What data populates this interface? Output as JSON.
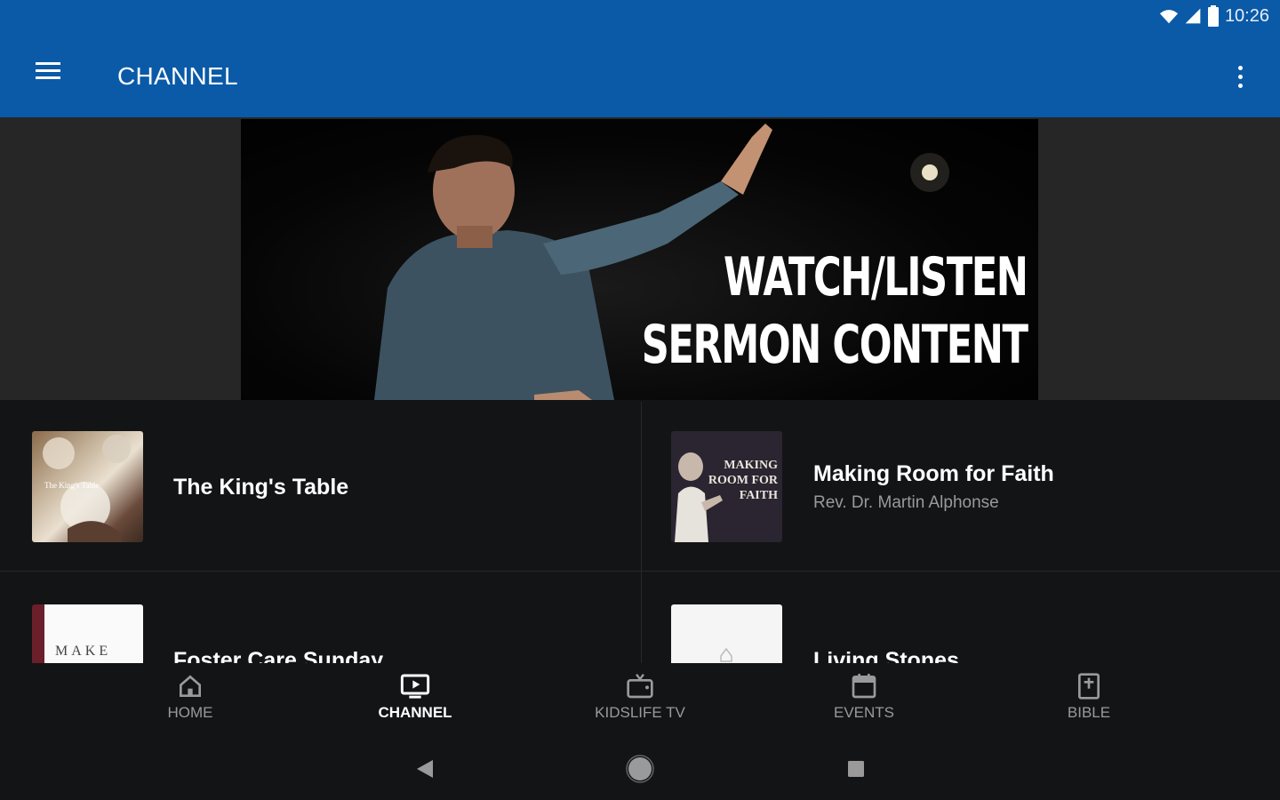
{
  "status_bar": {
    "time": "10:26",
    "icons": [
      "wifi-icon",
      "signal-icon",
      "battery-icon"
    ]
  },
  "app_bar": {
    "title": "CHANNEL",
    "menu_icon": "hamburger-menu-icon",
    "overflow_icon": "more-vert-icon"
  },
  "hero": {
    "line1": "WATCH/LISTEN",
    "line2": "SERMON CONTENT"
  },
  "tiles": [
    {
      "title": "The King's Table",
      "subtitle": "",
      "thumb_text": "The King's Table"
    },
    {
      "title": "Making Room for Faith",
      "subtitle": "Rev. Dr. Martin Alphonse",
      "thumb_text": "MAKING ROOM FOR FAITH"
    },
    {
      "title": "Foster Care Sunday",
      "subtitle": "",
      "thumb_text": "MAKE"
    },
    {
      "title": "Living Stones",
      "subtitle": "",
      "thumb_text": ""
    }
  ],
  "bottom_nav": [
    {
      "label": "HOME",
      "icon": "home-icon",
      "active": false
    },
    {
      "label": "CHANNEL",
      "icon": "tv-play-icon",
      "active": true
    },
    {
      "label": "KIDSLIFE TV",
      "icon": "retro-tv-icon",
      "active": false
    },
    {
      "label": "EVENTS",
      "icon": "calendar-icon",
      "active": false
    },
    {
      "label": "BIBLE",
      "icon": "bible-icon",
      "active": false
    }
  ],
  "system_nav": [
    "back-icon",
    "home-circle-icon",
    "recents-icon"
  ],
  "colors": {
    "app_bar": "#0a5aa8",
    "background": "#131416",
    "hero_band": "#262626",
    "muted_text": "#9a9a9a"
  }
}
